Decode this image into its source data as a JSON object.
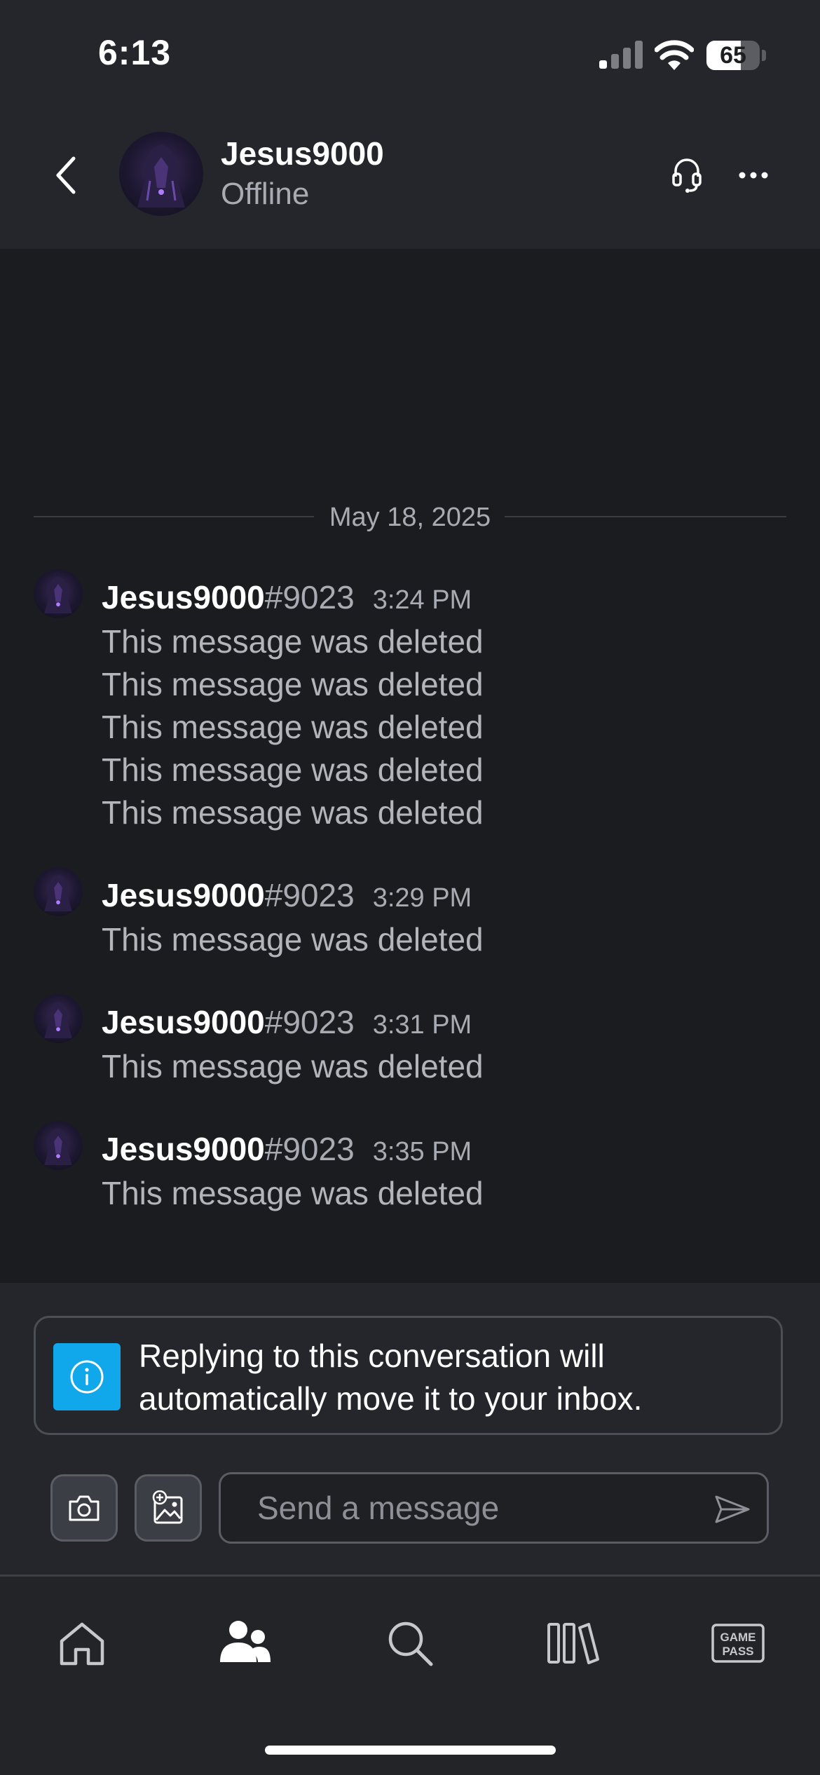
{
  "status_bar": {
    "time": "6:13",
    "battery": "65",
    "battery_fraction": 0.65
  },
  "header": {
    "contact_name": "Jesus9000",
    "contact_status": "Offline"
  },
  "chat": {
    "date_divider": "May 18, 2025",
    "groups": [
      {
        "name": "Jesus9000",
        "tag": "#9023",
        "time": "3:24 PM",
        "messages": [
          "This message was deleted",
          "This message was deleted",
          "This message was deleted",
          "This message was deleted",
          "This message was deleted"
        ]
      },
      {
        "name": "Jesus9000",
        "tag": "#9023",
        "time": "3:29 PM",
        "messages": [
          "This message was deleted"
        ]
      },
      {
        "name": "Jesus9000",
        "tag": "#9023",
        "time": "3:31 PM",
        "messages": [
          "This message was deleted"
        ]
      },
      {
        "name": "Jesus9000",
        "tag": "#9023",
        "time": "3:35 PM",
        "messages": [
          "This message was deleted"
        ]
      }
    ]
  },
  "composer": {
    "notice_line1": "Replying to this conversation will",
    "notice_line2": "automatically move it to your inbox.",
    "placeholder": "Send a message"
  },
  "tabbar": {
    "items": [
      "home-icon",
      "friends-icon",
      "search-icon",
      "library-icon",
      "game-pass-icon"
    ],
    "active": "friends-icon",
    "game_pass_line1": "GAME",
    "game_pass_line2": "PASS"
  },
  "colors": {
    "accent": "#10a8ea",
    "background": "#1b1c20",
    "bar": "#24262b"
  }
}
